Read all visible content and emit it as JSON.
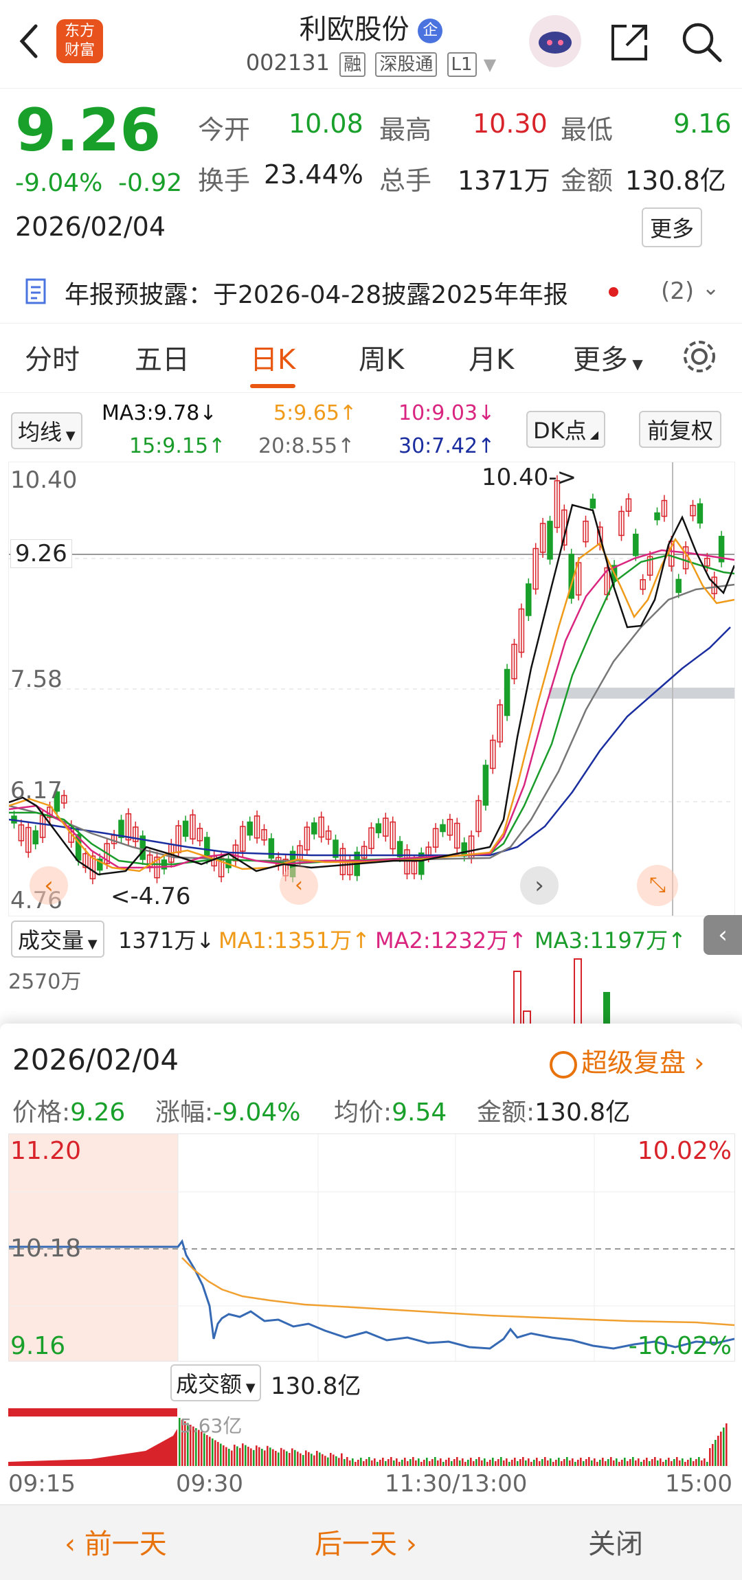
{
  "header": {
    "logo": [
      "东方",
      "财富"
    ],
    "stock_name": "利欧股份",
    "enterprise_badge": "企",
    "code": "002131",
    "tags": [
      "融",
      "深股通",
      "L1"
    ]
  },
  "quote": {
    "price": "9.26",
    "change_pct": "-9.04%",
    "change_amt": "-0.92",
    "date": "2026/02/04",
    "labels": {
      "open": "今开",
      "high": "最高",
      "low": "最低",
      "turnover": "换手",
      "volume": "总手",
      "amount": "金额"
    },
    "open": "10.08",
    "high": "10.30",
    "low": "9.16",
    "turnover": "23.44%",
    "volume": "1371万",
    "amount": "130.8亿",
    "more_button": "更多"
  },
  "notice": {
    "text": "年报预披露：于2026-04-28披露2025年年报",
    "count": "(2)"
  },
  "tabs": [
    "分时",
    "五日",
    "日K",
    "周K",
    "月K",
    "更多"
  ],
  "ma_bar": {
    "selector": "均线",
    "ma3": "MA3:9.78↓",
    "ma5": "5:9.65↑",
    "ma10": "10:9.03↓",
    "ma15": "15:9.15↑",
    "ma20": "20:8.55↑",
    "ma30": "30:7.42↑",
    "dk_button": "DK点",
    "adjust_button": "前复权"
  },
  "kchart": {
    "y_labels": [
      "10.40",
      "9.26",
      "7.58",
      "6.17",
      "4.76"
    ],
    "max_annotation": "10.40->",
    "min_annotation": "<-4.76",
    "colors": {
      "ma3": "#111111",
      "ma5": "#f09a1a",
      "ma10": "#d9257f",
      "ma15": "#1a9c2a",
      "ma20": "#777777",
      "ma30": "#1a2ea0"
    }
  },
  "volume_bar": {
    "selector": "成交量",
    "value": "1371万↓",
    "ma1": "MA1:1351万↑",
    "ma2": "MA2:1232万↑",
    "ma3": "MA3:1197万↑",
    "y_label": "2570万"
  },
  "popup": {
    "date": "2026/02/04",
    "replay": "超级复盘",
    "price": {
      "label": "价格:",
      "value": "9.26"
    },
    "change": {
      "label": "涨幅:",
      "value": "-9.04%"
    },
    "avg": {
      "label": "均价:",
      "value": "9.54"
    },
    "amount": {
      "label": "金额:",
      "value": "130.8亿"
    },
    "intraday": {
      "y_high": "11.20",
      "y_mid": "10.18",
      "y_low": "9.16",
      "pct_high": "10.02%",
      "pct_low": "-10.02%"
    },
    "amount_selector": "成交额",
    "amount_value": "130.8亿",
    "amount_peak": "5.63亿",
    "times": [
      "09:15",
      "09:30",
      "11:30/13:00",
      "15:00"
    ]
  },
  "footer": {
    "prev": "前一天",
    "next": "后一天",
    "close": "关闭"
  }
}
